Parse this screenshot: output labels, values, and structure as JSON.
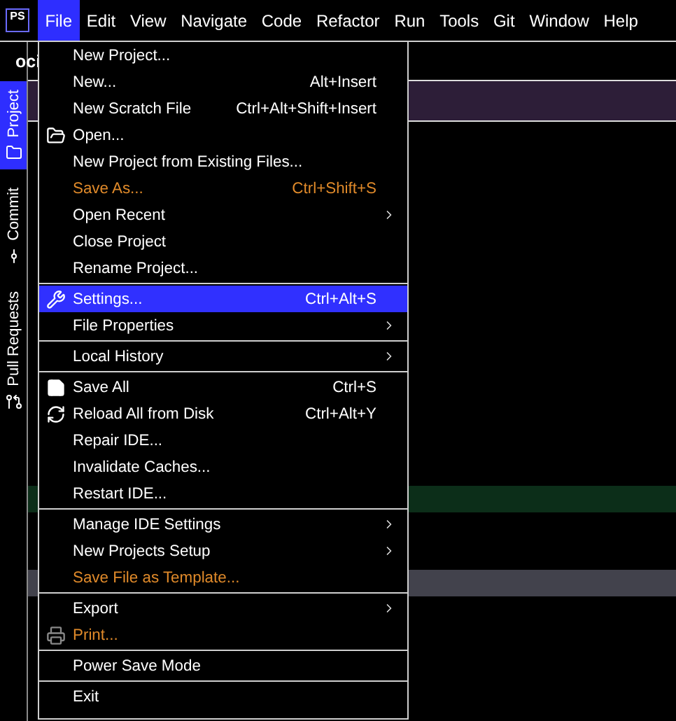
{
  "menu_bar": {
    "logo": "PS",
    "items": [
      {
        "label": "File",
        "selected": true
      },
      {
        "label": "Edit",
        "selected": false
      },
      {
        "label": "View",
        "selected": false
      },
      {
        "label": "Navigate",
        "selected": false
      },
      {
        "label": "Code",
        "selected": false
      },
      {
        "label": "Refactor",
        "selected": false
      },
      {
        "label": "Run",
        "selected": false
      },
      {
        "label": "Tools",
        "selected": false
      },
      {
        "label": "Git",
        "selected": false
      },
      {
        "label": "Window",
        "selected": false
      },
      {
        "label": "Help",
        "selected": false
      }
    ]
  },
  "tool_stripe": {
    "tabs": [
      {
        "label": "Project",
        "selected": true
      },
      {
        "label": "Commit",
        "selected": false
      },
      {
        "label": "Pull Requests",
        "selected": false
      }
    ]
  },
  "editor": {
    "tab_label": "oci"
  },
  "file_menu": {
    "groups": [
      [
        {
          "label": "New Project...",
          "disabled": false,
          "selected": false,
          "submenu": false
        },
        {
          "label": "New...",
          "shortcut": "Alt+Insert",
          "disabled": false,
          "selected": false,
          "submenu": false
        },
        {
          "label": "New Scratch File",
          "shortcut": "Ctrl+Alt+Shift+Insert",
          "disabled": false,
          "selected": false,
          "submenu": false
        },
        {
          "label": "Open...",
          "disabled": false,
          "selected": false,
          "submenu": false
        },
        {
          "label": "New Project from Existing Files...",
          "disabled": false,
          "selected": false,
          "submenu": false
        },
        {
          "label": "Save As...",
          "shortcut": "Ctrl+Shift+S",
          "disabled": true,
          "selected": false,
          "submenu": false
        },
        {
          "label": "Open Recent",
          "disabled": false,
          "selected": false,
          "submenu": true
        },
        {
          "label": "Close Project",
          "disabled": false,
          "selected": false,
          "submenu": false
        },
        {
          "label": "Rename Project...",
          "disabled": false,
          "selected": false,
          "submenu": false
        }
      ],
      [
        {
          "label": "Settings...",
          "shortcut": "Ctrl+Alt+S",
          "disabled": false,
          "selected": true,
          "submenu": false
        },
        {
          "label": "File Properties",
          "disabled": false,
          "selected": false,
          "submenu": true
        }
      ],
      [
        {
          "label": "Local History",
          "disabled": false,
          "selected": false,
          "submenu": true
        }
      ],
      [
        {
          "label": "Save All",
          "shortcut": "Ctrl+S",
          "disabled": false,
          "selected": false,
          "submenu": false
        },
        {
          "label": "Reload All from Disk",
          "shortcut": "Ctrl+Alt+Y",
          "disabled": false,
          "selected": false,
          "submenu": false
        },
        {
          "label": "Repair IDE...",
          "disabled": false,
          "selected": false,
          "submenu": false
        },
        {
          "label": "Invalidate Caches...",
          "disabled": false,
          "selected": false,
          "submenu": false
        },
        {
          "label": "Restart IDE...",
          "disabled": false,
          "selected": false,
          "submenu": false
        }
      ],
      [
        {
          "label": "Manage IDE Settings",
          "disabled": false,
          "selected": false,
          "submenu": true
        },
        {
          "label": "New Projects Setup",
          "disabled": false,
          "selected": false,
          "submenu": true
        },
        {
          "label": "Save File as Template...",
          "disabled": true,
          "selected": false,
          "submenu": false
        }
      ],
      [
        {
          "label": "Export",
          "disabled": false,
          "selected": false,
          "submenu": true
        },
        {
          "label": "Print...",
          "disabled": true,
          "selected": false,
          "submenu": false
        }
      ],
      [
        {
          "label": "Power Save Mode",
          "disabled": false,
          "selected": false,
          "submenu": false
        }
      ],
      [
        {
          "label": "Exit",
          "disabled": false,
          "selected": false,
          "submenu": false
        }
      ]
    ]
  }
}
